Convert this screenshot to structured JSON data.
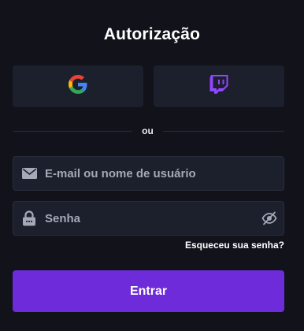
{
  "title": "Autorização",
  "social": {
    "google_icon": "google-icon",
    "twitch_icon": "twitch-icon"
  },
  "divider": {
    "label": "ou"
  },
  "email": {
    "placeholder": "E-mail ou nome de usuário",
    "value": "",
    "icon": "envelope-icon"
  },
  "password": {
    "placeholder": "Senha",
    "value": "",
    "icon": "lock-icon",
    "toggle_icon": "eye-slash-icon"
  },
  "forgot_label": "Esqueceu sua senha?",
  "submit_label": "Entrar",
  "colors": {
    "background": "#11121a",
    "surface": "#1c1f2c",
    "primary": "#6e2bd9",
    "twitch": "#9146ff",
    "placeholder": "#a5a8b6"
  }
}
